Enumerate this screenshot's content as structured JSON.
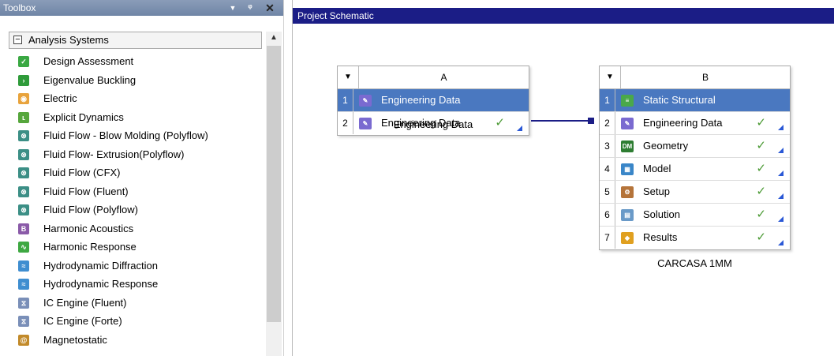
{
  "toolbox": {
    "title": "Toolbox",
    "dropdown_icon": "▼",
    "pin_icon": "ᵠ",
    "close_icon": "✕",
    "group": {
      "toggle": "−",
      "label": "Analysis Systems"
    },
    "items": [
      {
        "label": "Design Assessment",
        "icon": "design-assessment-icon",
        "color": "#3aa843",
        "glyph": "✓"
      },
      {
        "label": "Eigenvalue Buckling",
        "icon": "eigenvalue-buckling-icon",
        "color": "#2f9b3a",
        "glyph": "›"
      },
      {
        "label": "Electric",
        "icon": "electric-icon",
        "color": "#e8a33c",
        "glyph": "◉"
      },
      {
        "label": "Explicit Dynamics",
        "icon": "explicit-dynamics-icon",
        "color": "#56a63c",
        "glyph": "ʟ"
      },
      {
        "label": "Fluid Flow - Blow Molding (Polyflow)",
        "icon": "fluid-flow-icon",
        "color": "#3c8f86",
        "glyph": "⊗"
      },
      {
        "label": "Fluid Flow- Extrusion(Polyflow)",
        "icon": "fluid-flow-icon",
        "color": "#3c8f86",
        "glyph": "⊗"
      },
      {
        "label": "Fluid Flow (CFX)",
        "icon": "fluid-flow-icon",
        "color": "#3c8f86",
        "glyph": "⊗"
      },
      {
        "label": "Fluid Flow (Fluent)",
        "icon": "fluid-flow-icon",
        "color": "#3c8f86",
        "glyph": "⊗"
      },
      {
        "label": "Fluid Flow (Polyflow)",
        "icon": "fluid-flow-icon",
        "color": "#3c8f86",
        "glyph": "⊗"
      },
      {
        "label": "Harmonic Acoustics",
        "icon": "harmonic-acoustics-icon",
        "color": "#8a5aa8",
        "glyph": "B"
      },
      {
        "label": "Harmonic Response",
        "icon": "harmonic-response-icon",
        "color": "#3ea842",
        "glyph": "∿"
      },
      {
        "label": "Hydrodynamic Diffraction",
        "icon": "hydrodynamic-diffraction-icon",
        "color": "#3f8ed0",
        "glyph": "≈"
      },
      {
        "label": "Hydrodynamic Response",
        "icon": "hydrodynamic-response-icon",
        "color": "#3f8ed0",
        "glyph": "≈"
      },
      {
        "label": "IC Engine (Fluent)",
        "icon": "ic-engine-icon",
        "color": "#7a8fb8",
        "glyph": "⧖"
      },
      {
        "label": "IC Engine (Forte)",
        "icon": "ic-engine-icon",
        "color": "#7a8fb8",
        "glyph": "⧖"
      },
      {
        "label": "Magnetostatic",
        "icon": "magnetostatic-icon",
        "color": "#c28a2a",
        "glyph": "@"
      }
    ],
    "scroll_up": "▲"
  },
  "schematic": {
    "title": "Project Schematic",
    "system_a": {
      "menu": "▼",
      "column": "A",
      "caption": "Engineering Data",
      "rows": [
        {
          "num": "1",
          "label": "Engineering Data",
          "icon": "engineering-data-icon",
          "color": "#7a6ad0",
          "glyph": "✎",
          "check": "",
          "selected": true
        },
        {
          "num": "2",
          "label": "Engineering Data",
          "icon": "engineering-data-icon",
          "color": "#7a6ad0",
          "glyph": "✎",
          "check": "✓",
          "selected": false
        }
      ]
    },
    "system_b": {
      "menu": "▼",
      "column": "B",
      "caption": "CARCASA 1MM",
      "rows": [
        {
          "num": "1",
          "label": "Static Structural",
          "icon": "static-structural-icon",
          "color": "#4aa84a",
          "glyph": "≡",
          "check": "",
          "selected": true
        },
        {
          "num": "2",
          "label": "Engineering Data",
          "icon": "engineering-data-icon",
          "color": "#7a6ad0",
          "glyph": "✎",
          "check": "✓",
          "selected": false
        },
        {
          "num": "3",
          "label": "Geometry",
          "icon": "geometry-icon",
          "color": "#2e7d32",
          "glyph": "DM",
          "check": "✓",
          "selected": false
        },
        {
          "num": "4",
          "label": "Model",
          "icon": "model-icon",
          "color": "#3a86c8",
          "glyph": "▦",
          "check": "✓",
          "selected": false
        },
        {
          "num": "5",
          "label": "Setup",
          "icon": "setup-icon",
          "color": "#b5743a",
          "glyph": "⚙",
          "check": "✓",
          "selected": false
        },
        {
          "num": "6",
          "label": "Solution",
          "icon": "solution-icon",
          "color": "#6a9ac8",
          "glyph": "▤",
          "check": "✓",
          "selected": false
        },
        {
          "num": "7",
          "label": "Results",
          "icon": "results-icon",
          "color": "#e0a020",
          "glyph": "◆",
          "check": "✓",
          "selected": false
        }
      ]
    }
  }
}
